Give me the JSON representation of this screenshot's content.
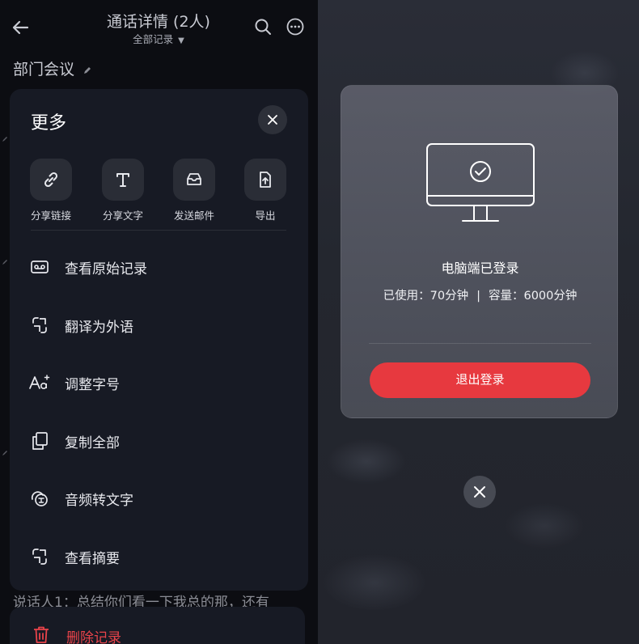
{
  "header": {
    "title": "通话详情 (2人)",
    "filter_label": "全部记录",
    "caret": "▼"
  },
  "meeting": {
    "name": "部门会议"
  },
  "background_text": "说话人1：总结你们看一下我总的那，还有",
  "sheet": {
    "title": "更多",
    "share_actions": [
      {
        "label": "分享链接",
        "icon": "link-icon"
      },
      {
        "label": "分享文字",
        "icon": "text-icon"
      },
      {
        "label": "发送邮件",
        "icon": "mail-icon"
      },
      {
        "label": "导出",
        "icon": "export-icon"
      }
    ],
    "menu_items": [
      {
        "label": "查看原始记录",
        "icon": "recording-icon"
      },
      {
        "label": "翻译为外语",
        "icon": "translate-icon"
      },
      {
        "label": "调整字号",
        "icon": "font-size-icon"
      },
      {
        "label": "复制全部",
        "icon": "copy-icon"
      },
      {
        "label": "音频转文字",
        "icon": "audio-to-text-icon"
      },
      {
        "label": "查看摘要",
        "icon": "summary-icon"
      }
    ],
    "delete_label": "删除记录"
  },
  "login_card": {
    "status": "电脑端已登录",
    "used": "已使用：70分钟",
    "separator": "|",
    "capacity": "容量：6000分钟",
    "logout_label": "退出登录"
  },
  "colors": {
    "accent_red": "#e7393f",
    "panel_bg": "#171a24",
    "page_bg": "#0c0d12"
  }
}
